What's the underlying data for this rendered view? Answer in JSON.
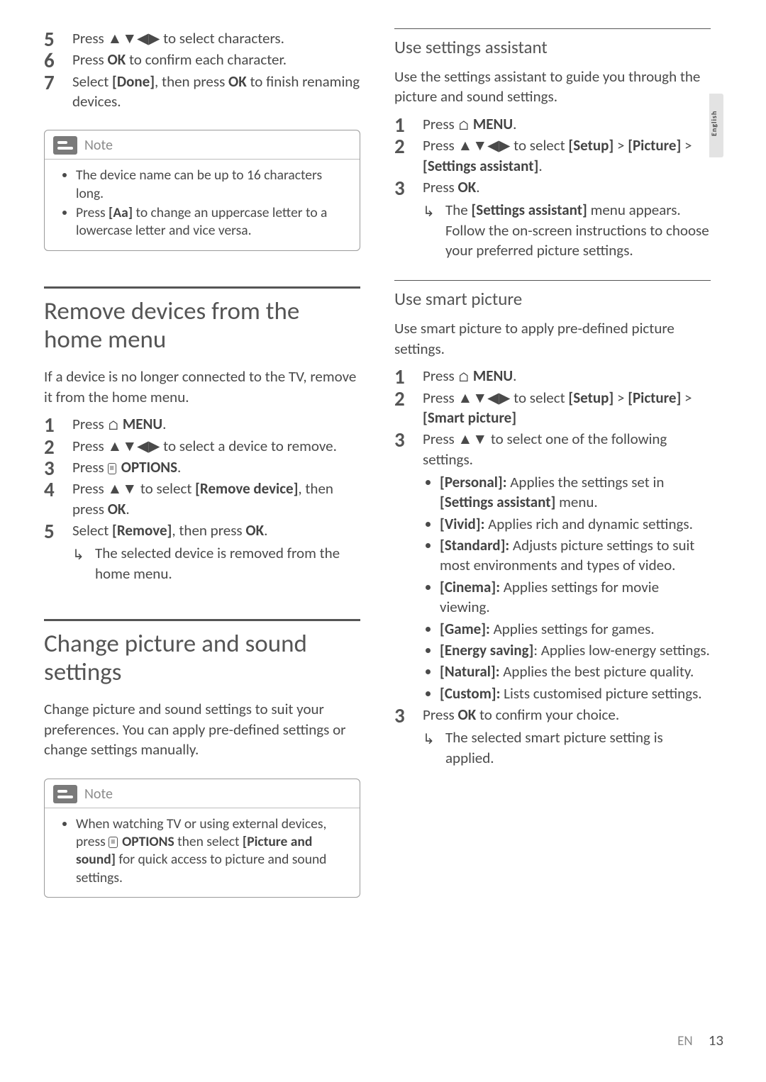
{
  "lang_tab": "English",
  "footer": {
    "code": "EN",
    "page": "13"
  },
  "left": {
    "top_steps": [
      {
        "n": "5",
        "pre": "Press ",
        "icon": "▲▼◀▶",
        "post": " to select characters."
      },
      {
        "n": "6",
        "pre": "Press ",
        "bold": "OK",
        "post": " to confirm each character."
      },
      {
        "n": "7",
        "pre": "Select ",
        "bold": "[Done]",
        "mid": ", then press ",
        "bold2": "OK",
        "post": " to finish renaming devices."
      }
    ],
    "note1": {
      "label": "Note",
      "items": [
        "The device name can be up to 16 characters long.",
        "Press [Aa] to change an uppercase letter to a lowercase letter and vice versa."
      ]
    },
    "sec1": {
      "title": "Remove devices from the home menu",
      "intro": "If a device is no longer connected to the TV, remove it from the home menu.",
      "steps": {
        "s1": {
          "pre": "Press ",
          "icon": "home",
          "bold": "MENU",
          "post": "."
        },
        "s2": {
          "pre": "Press ",
          "icon": "▲▼◀▶",
          "post": " to select a device to remove."
        },
        "s3": {
          "pre": "Press ",
          "icon": "options",
          "bold": "OPTIONS",
          "post": "."
        },
        "s4": {
          "pre": "Press ",
          "icon": "▲▼",
          "mid": " to select ",
          "bold": "[Remove device]",
          "post": ", then press ",
          "bold2": "OK",
          "tail": "."
        },
        "s5": {
          "pre": "Select ",
          "bold": "[Remove]",
          "mid": ", then press ",
          "bold2": "OK",
          "post": ".",
          "result": "The selected device is removed from the home menu."
        }
      }
    },
    "sec2": {
      "title": "Change picture and sound settings",
      "intro": "Change picture and sound settings to suit your preferences. You can apply pre-defined settings or change settings manually."
    },
    "note2": {
      "label": "Note",
      "text_parts": {
        "a": "When watching TV or using external devices, press ",
        "b": "OPTIONS",
        "c": " then select ",
        "d": "[Picture and sound]",
        "e": " for quick access to picture and sound settings."
      }
    }
  },
  "right": {
    "sec1": {
      "title": "Use settings assistant",
      "intro": "Use the settings assistant to guide you through the picture and sound settings.",
      "steps": {
        "s1": {
          "pre": "Press ",
          "icon": "home",
          "bold": "MENU",
          "post": "."
        },
        "s2": {
          "pre": "Press ",
          "icon": "▲▼◀▶",
          "mid": " to select ",
          "b1": "[Setup]",
          "gt1": " > ",
          "b2": "[Picture]",
          "gt2": " > ",
          "b3": "[Settings assistant]",
          "post": "."
        },
        "s3": {
          "pre": "Press ",
          "bold": "OK",
          "post": ".",
          "result_parts": {
            "a": "The ",
            "b": "[Settings assistant]",
            "c": " menu appears. Follow the on-screen instructions to choose your preferred picture settings."
          }
        }
      }
    },
    "sec2": {
      "title": "Use smart picture",
      "intro": "Use smart picture to apply pre-defined picture settings.",
      "steps": {
        "s1": {
          "pre": "Press ",
          "icon": "home",
          "bold": "MENU",
          "post": "."
        },
        "s2": {
          "pre": "Press ",
          "icon": "▲▼◀▶",
          "mid": " to select ",
          "b1": "[Setup]",
          "gt1": " > ",
          "b2": "[Picture]",
          "gt2": " > ",
          "b3": "[Smart picture]"
        },
        "s3a": {
          "pre": "Press ",
          "icon": "▲▼",
          "post": " to select one of the following settings."
        },
        "options": [
          {
            "b": "[Personal]:",
            "t": " Applies the settings set in ",
            "b2": "[Settings assistant]",
            "t2": " menu."
          },
          {
            "b": "[Vivid]:",
            "t": " Applies rich and dynamic settings."
          },
          {
            "b": "[Standard]:",
            "t": " Adjusts picture settings to suit most environments and types of video."
          },
          {
            "b": "[Cinema]:",
            "t": " Applies settings for movie viewing."
          },
          {
            "b": "[Game]:",
            "t": " Applies settings for games."
          },
          {
            "b": "[Energy saving]",
            "t": ": Applies low-energy settings."
          },
          {
            "b": "[Natural]:",
            "t": " Applies the best picture quality."
          },
          {
            "b": "[Custom]:",
            "t": " Lists customised picture settings."
          }
        ],
        "s3b": {
          "pre": "Press ",
          "bold": "OK",
          "post": " to confirm your choice.",
          "result": "The selected smart picture setting is applied."
        }
      }
    }
  }
}
